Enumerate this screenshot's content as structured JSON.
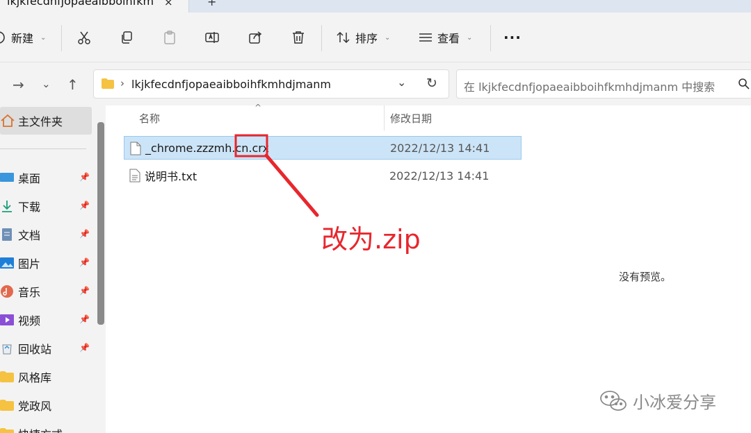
{
  "tab": {
    "title": "lkjkfecdnfjopaeaibboihfkm",
    "close": "×",
    "new": "+"
  },
  "toolbar": {
    "new_label": "新建",
    "sort_label": "排序",
    "view_label": "查看",
    "more_label": "···"
  },
  "address": {
    "path": "lkjkfecdnfjopaeaibboihfkmhdjmanm",
    "search_placeholder": "在 lkjkfecdnfjopaeaibboihfkmhdjmanm 中搜索"
  },
  "sidebar": {
    "home": "主文件夹",
    "items": [
      {
        "label": "桌面",
        "icon": "desktop-icon",
        "pinned": true
      },
      {
        "label": "下载",
        "icon": "download-icon",
        "pinned": true
      },
      {
        "label": "文档",
        "icon": "documents-icon",
        "pinned": true
      },
      {
        "label": "图片",
        "icon": "pictures-icon",
        "pinned": true
      },
      {
        "label": "音乐",
        "icon": "music-icon",
        "pinned": true
      },
      {
        "label": "视频",
        "icon": "videos-icon",
        "pinned": true
      },
      {
        "label": "回收站",
        "icon": "recycle-bin-icon",
        "pinned": true
      },
      {
        "label": "风格库",
        "icon": "folder-icon",
        "pinned": false
      },
      {
        "label": "党政风",
        "icon": "folder-icon",
        "pinned": false
      },
      {
        "label": "快捷方式",
        "icon": "folder-icon",
        "pinned": false
      }
    ]
  },
  "columns": {
    "name": "名称",
    "modified": "修改日期"
  },
  "files": [
    {
      "name": "_chrome.zzzmh.cn.crx",
      "modified": "2022/12/13 14:41",
      "selected": true
    },
    {
      "name": "说明书.txt",
      "modified": "2022/12/13 14:41",
      "selected": false
    }
  ],
  "preview": {
    "text": "没有预览。"
  },
  "annotation": {
    "text": "改为.zip",
    "color": "#e8262d"
  },
  "watermark": {
    "text": "小冰爱分享"
  }
}
